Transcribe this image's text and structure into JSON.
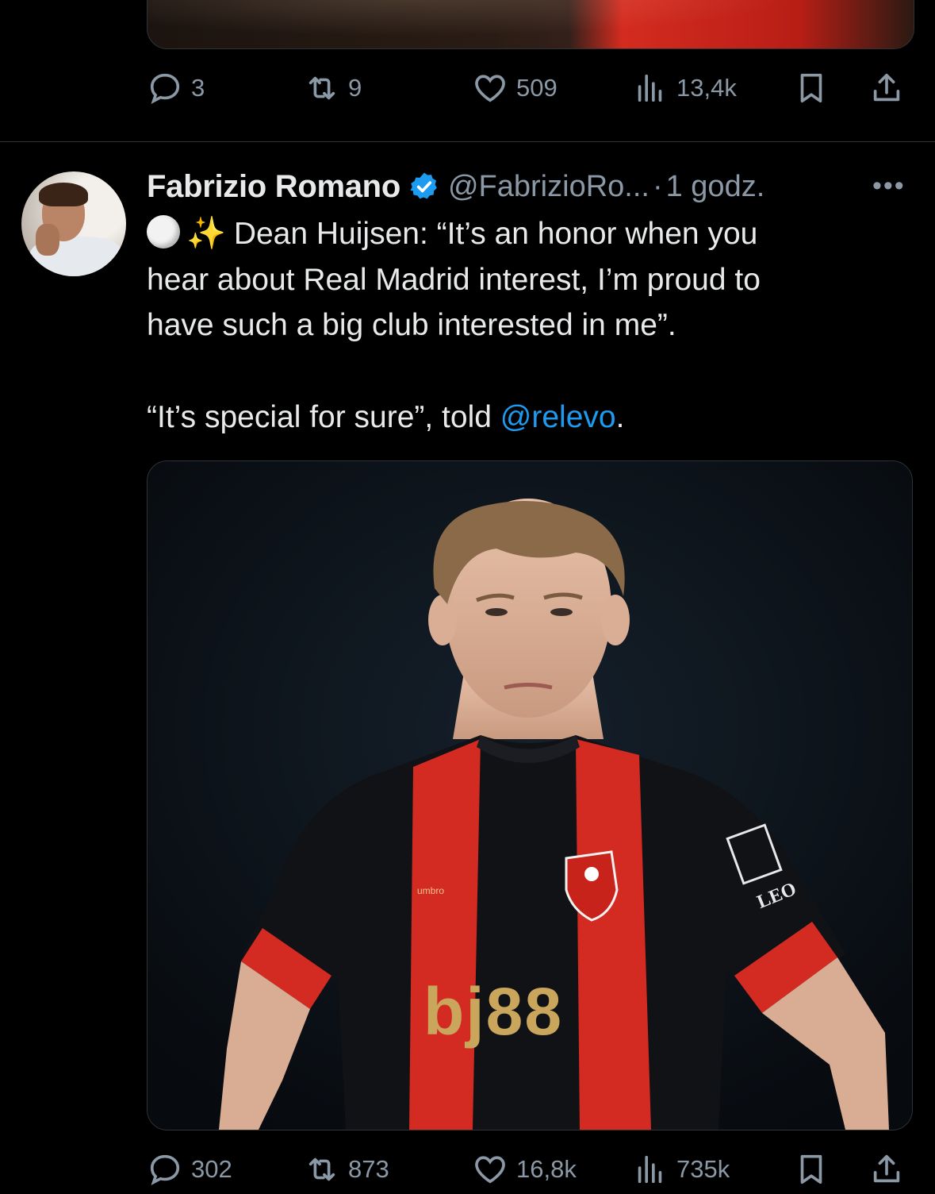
{
  "previous_tweet": {
    "actions": {
      "replies": "3",
      "reposts": "9",
      "likes": "509",
      "views": "13,4k"
    }
  },
  "tweet": {
    "author_name": "Fabrizio Romano",
    "handle": "@FabrizioRo...",
    "separator": "·",
    "time": "1 godz.",
    "more_label": "•••",
    "text_line1_prefix": "Dean Huijsen: “It’s an honor when you",
    "text_line2": "hear about Real Madrid interest, I’m proud to",
    "text_line3": "have such a big club interested in me”.",
    "text_quote": "“It’s special for sure”, told ",
    "mention": "@relevo",
    "text_end": ".",
    "sparkle_emoji": "✨",
    "image": {
      "shirt_sponsor": "bj88",
      "kit_brand": "umbro",
      "sleeve_sponsor": "LEO"
    },
    "actions": {
      "replies": "302",
      "reposts": "873",
      "likes": "16,8k",
      "views": "735k"
    }
  },
  "colors": {
    "background": "#000000",
    "text": "#e7e9ea",
    "secondary": "#8b98a5",
    "link": "#1d9bf0",
    "verified": "#1d9bf0"
  }
}
